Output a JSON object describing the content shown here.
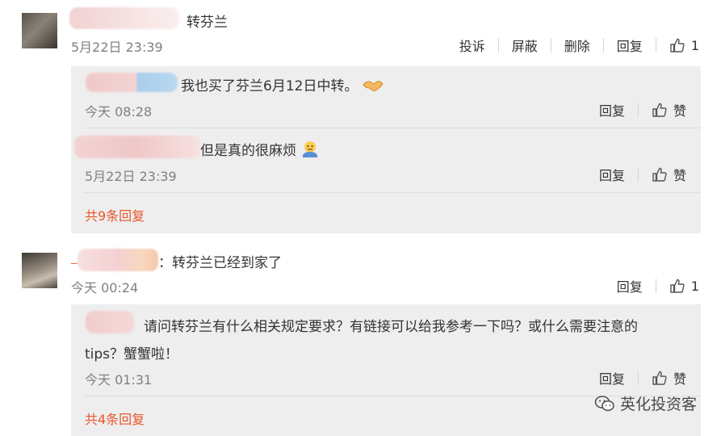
{
  "comments": [
    {
      "text": "转芬兰",
      "time": "5月22日 23:39",
      "actions": [
        "投诉",
        "屏蔽",
        "删除",
        "回复"
      ],
      "likes": "1",
      "replies": [
        {
          "text": "我也买了芬兰6月12日中转。",
          "time": "今天 08:28",
          "reply_label": "回复",
          "like_label": "赞"
        },
        {
          "text": "但是真的很麻烦",
          "time": "5月22日 23:39",
          "reply_label": "回复",
          "like_label": "赞"
        }
      ],
      "more_replies": "共9条回复"
    },
    {
      "name_prefix": "_",
      "text": "：转芬兰已经到家了",
      "time": "今天 00:24",
      "reply_label": "回复",
      "likes": "1",
      "replies": [
        {
          "text_line1": "请问转芬兰有什么相关规定要求？有链接可以给我参考一下吗？或什么需要注意的",
          "text_line2": "tips？蟹蟹啦！",
          "time": "今天 01:31",
          "reply_label": "回复",
          "like_label": "赞"
        }
      ],
      "more_replies": "共4条回复"
    }
  ],
  "watermark": {
    "label": "英化投资客",
    "icon": "wechat-icon"
  },
  "colors": {
    "accent": "#e8562a",
    "reply_bg": "#eeeeee",
    "time": "#808080"
  }
}
